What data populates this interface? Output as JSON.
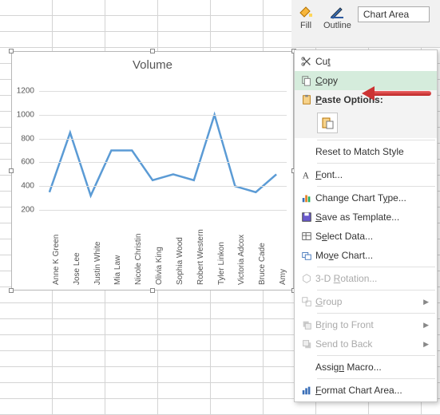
{
  "ribbon": {
    "fill": "Fill",
    "outline": "Outline",
    "chart_area": "Chart Area"
  },
  "chart_data": {
    "type": "line",
    "title": "Volume",
    "categories": [
      "Anne K Green",
      "Jose Lee",
      "Justin White",
      "Mia Law",
      "Nicole Christin",
      "Olivia King",
      "Sophia Wood",
      "Robert Western",
      "Tyler Linkon",
      "Victoria Adcox",
      "Bruce Cade",
      "Amy"
    ],
    "values": [
      350,
      850,
      320,
      700,
      700,
      450,
      500,
      450,
      1000,
      400,
      350,
      500
    ],
    "ylim": [
      0,
      1300
    ],
    "yticks": [
      200,
      400,
      600,
      800,
      1000,
      1200
    ],
    "xlabel": "",
    "ylabel": ""
  },
  "plus": "+",
  "ctx": {
    "cut": "Cut",
    "copy": "Copy",
    "paste_header": "Paste Options:",
    "reset": "Reset to Match Style",
    "font": "Font...",
    "change_type": "Change Chart Type...",
    "save_template": "Save as Template...",
    "select_data": "Select Data...",
    "move_chart": "Move Chart...",
    "rotation": "3-D Rotation...",
    "group": "Group",
    "bring_front": "Bring to Front",
    "send_back": "Send to Back",
    "assign_macro": "Assign Macro...",
    "format_area": "Format Chart Area..."
  },
  "accel": {
    "cut": "t",
    "copy": "C",
    "paste_header": "P",
    "reset": "A",
    "font": "F",
    "change_type": "y",
    "save_template": "S",
    "select_data": "e",
    "move_chart": "v",
    "rotation": "R",
    "group": "G",
    "bring_front": "r",
    "send_back": "K",
    "assign_macro": "n",
    "format_area": "F"
  }
}
